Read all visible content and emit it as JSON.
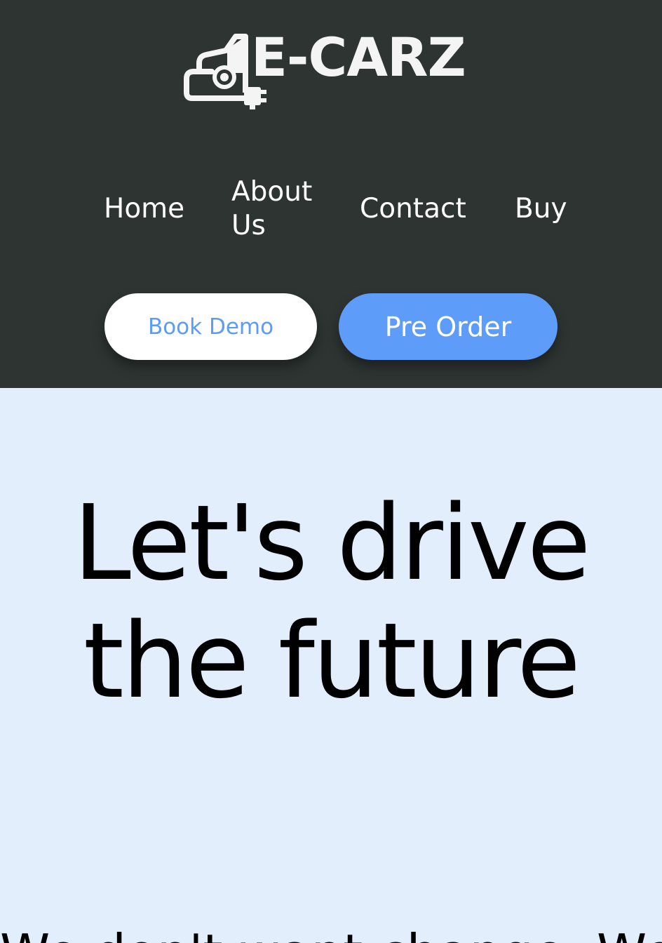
{
  "brand": {
    "name": "E-CARZ"
  },
  "nav": {
    "items": [
      {
        "label": "Home"
      },
      {
        "label": "About Us"
      },
      {
        "label": "Contact"
      },
      {
        "label": "Buy"
      }
    ]
  },
  "actions": {
    "book_demo": "Book Demo",
    "pre_order": "Pre Order"
  },
  "hero": {
    "title": "Let's drive the future",
    "subtitle": "We don't want change. We don't want t"
  },
  "colors": {
    "header_bg": "#2d3431",
    "page_bg": "#e3eefd",
    "accent": "#5d9cf9"
  },
  "icons": {
    "logo": "car-plug-icon"
  }
}
